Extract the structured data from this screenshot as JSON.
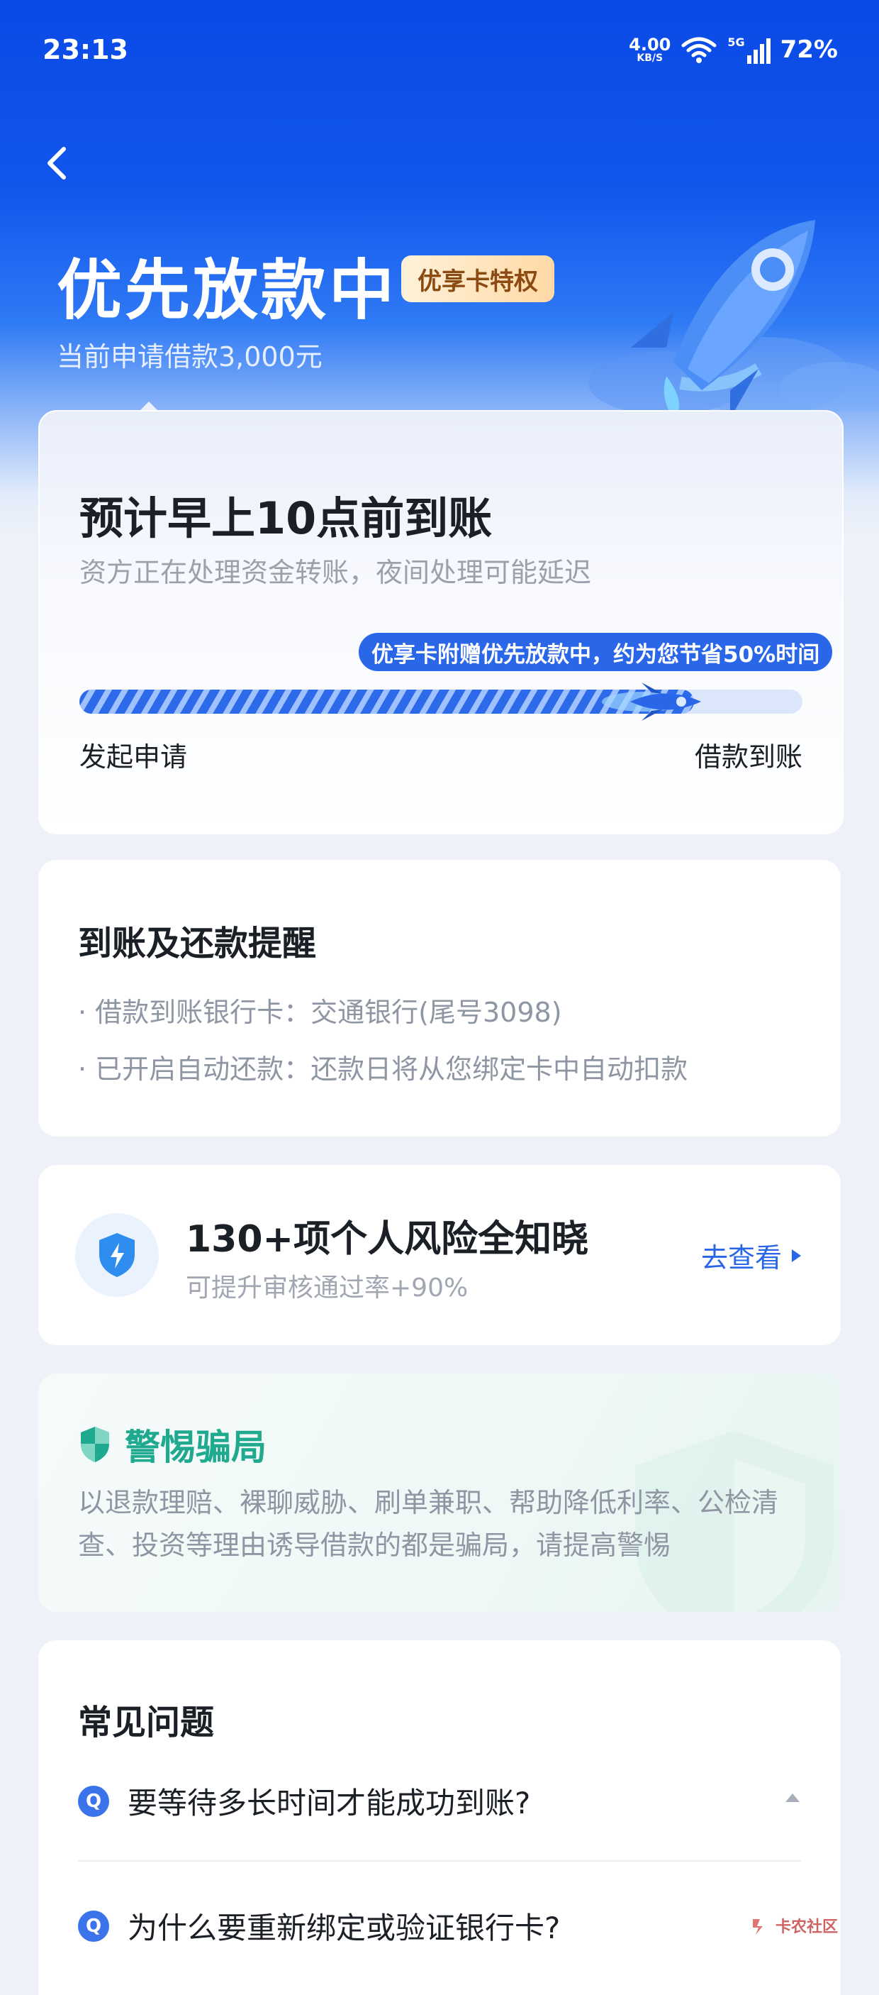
{
  "status_bar": {
    "time": "23:13",
    "net_speed_value": "4.00",
    "net_speed_unit": "KB/S",
    "wifi_icon": "wifi-icon",
    "signal_label": "5G",
    "battery": "72%"
  },
  "header": {
    "back_icon": "chevron-left-icon",
    "title": "优先放款中",
    "badge": "优享卡特权",
    "subtitle": "当前申请借款3,000元"
  },
  "eta_card": {
    "title": "预计早上10点前到账",
    "description": "资方正在处理资金转账，夜间处理可能延迟",
    "tip": "优享卡附赠优先放款中，约为您节省50%时间",
    "progress_fraction": 0.85,
    "start_label": "发起申请",
    "end_label": "借款到账"
  },
  "reminder_card": {
    "title": "到账及还款提醒",
    "items": [
      "· 借款到账银行卡：交通银行(尾号3098)",
      "· 已开启自动还款：还款日将从您绑定卡中自动扣款"
    ]
  },
  "risk_card": {
    "icon": "shield-lightning-icon",
    "title": "130+项个人风险全知晓",
    "description": "可提升审核通过率+90%",
    "action": "去查看"
  },
  "scam_card": {
    "icon": "shield-icon",
    "title": "警惕骗局",
    "text": "以退款理赔、裸聊威胁、刷单兼职、帮助降低利率、公检清查、投资等理由诱导借款的都是骗局，请提高警惕"
  },
  "faq": {
    "title": "常见问题",
    "badge": "Q",
    "questions": [
      "要等待多长时间才能成功到账?",
      "为什么要重新绑定或验证银行卡?"
    ]
  },
  "watermark": {
    "text": "卡农社区"
  },
  "colors": {
    "brand_blue": "#1256ec",
    "accent_blue": "#2a67e8",
    "scam_green": "#1fa98f"
  }
}
